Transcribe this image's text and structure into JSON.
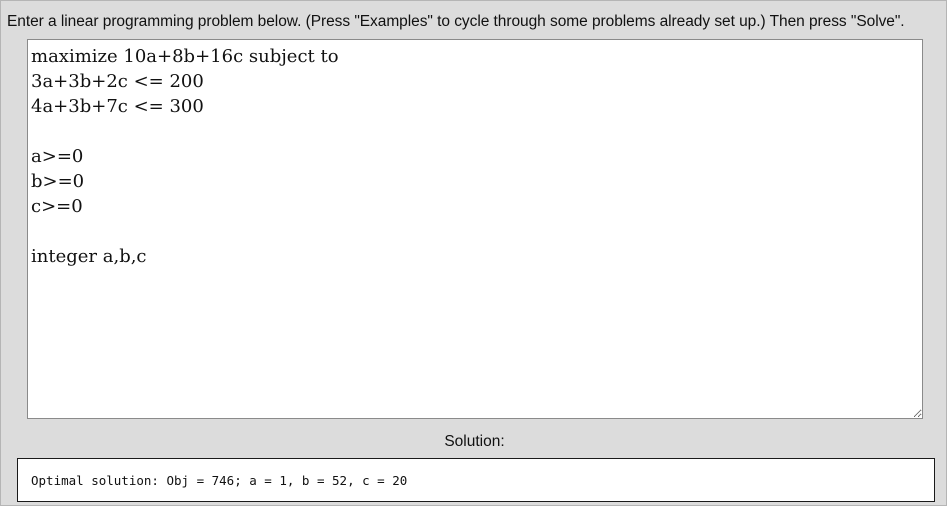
{
  "instructions": "Enter a linear programming problem below. (Press \"Examples\" to cycle through some problems already set up.) Then press \"Solve\".",
  "problem_input": {
    "value": "maximize 10a+8b+16c subject to\n3a+3b+2c <= 200\n4a+3b+7c <= 300\n\na>=0\nb>=0\nc>=0\n\ninteger a,b,c"
  },
  "solution": {
    "label": "Solution:",
    "text": "Optimal solution: Obj = 746; a = 1, b = 52, c = 20"
  }
}
